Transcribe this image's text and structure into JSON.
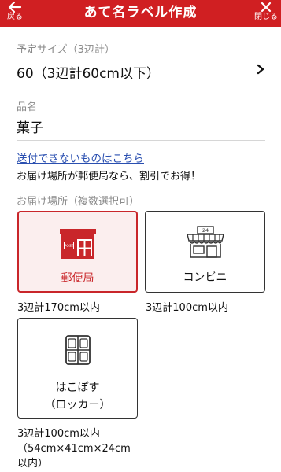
{
  "header": {
    "title": "あて名ラベル作成",
    "back_label": "戻る",
    "close_label": "閉じる",
    "bg_color": "#d01f22"
  },
  "size": {
    "label": "予定サイズ（3辺計）",
    "value": "60（3辺計60cm以下）"
  },
  "item": {
    "label": "品名",
    "value": "菓子"
  },
  "unsendable_link": "送付できないものはこちら",
  "discount_note": "お届け場所が郵便局なら、割引でお得！",
  "destination": {
    "label": "お届け場所（複数選択可）",
    "options": [
      {
        "label": "郵便局",
        "icon": "post-office-icon",
        "selected": true,
        "size_note": "3辺計170cm以内"
      },
      {
        "label": "コンビニ",
        "icon": "convenience-store-icon",
        "selected": false,
        "size_note": "3辺計100cm以内"
      },
      {
        "label_line1": "はこぽす",
        "label_line2": "（ロッカー）",
        "icon": "locker-icon",
        "selected": false,
        "size_note_line1": "3辺計100cm以内",
        "size_note_line2": "（54cm×41cm×24cm",
        "size_note_line3": "以内）"
      }
    ]
  },
  "colors": {
    "accent": "#d01f22",
    "link": "#2a4fb0",
    "selected_bg": "#fbeeee"
  }
}
